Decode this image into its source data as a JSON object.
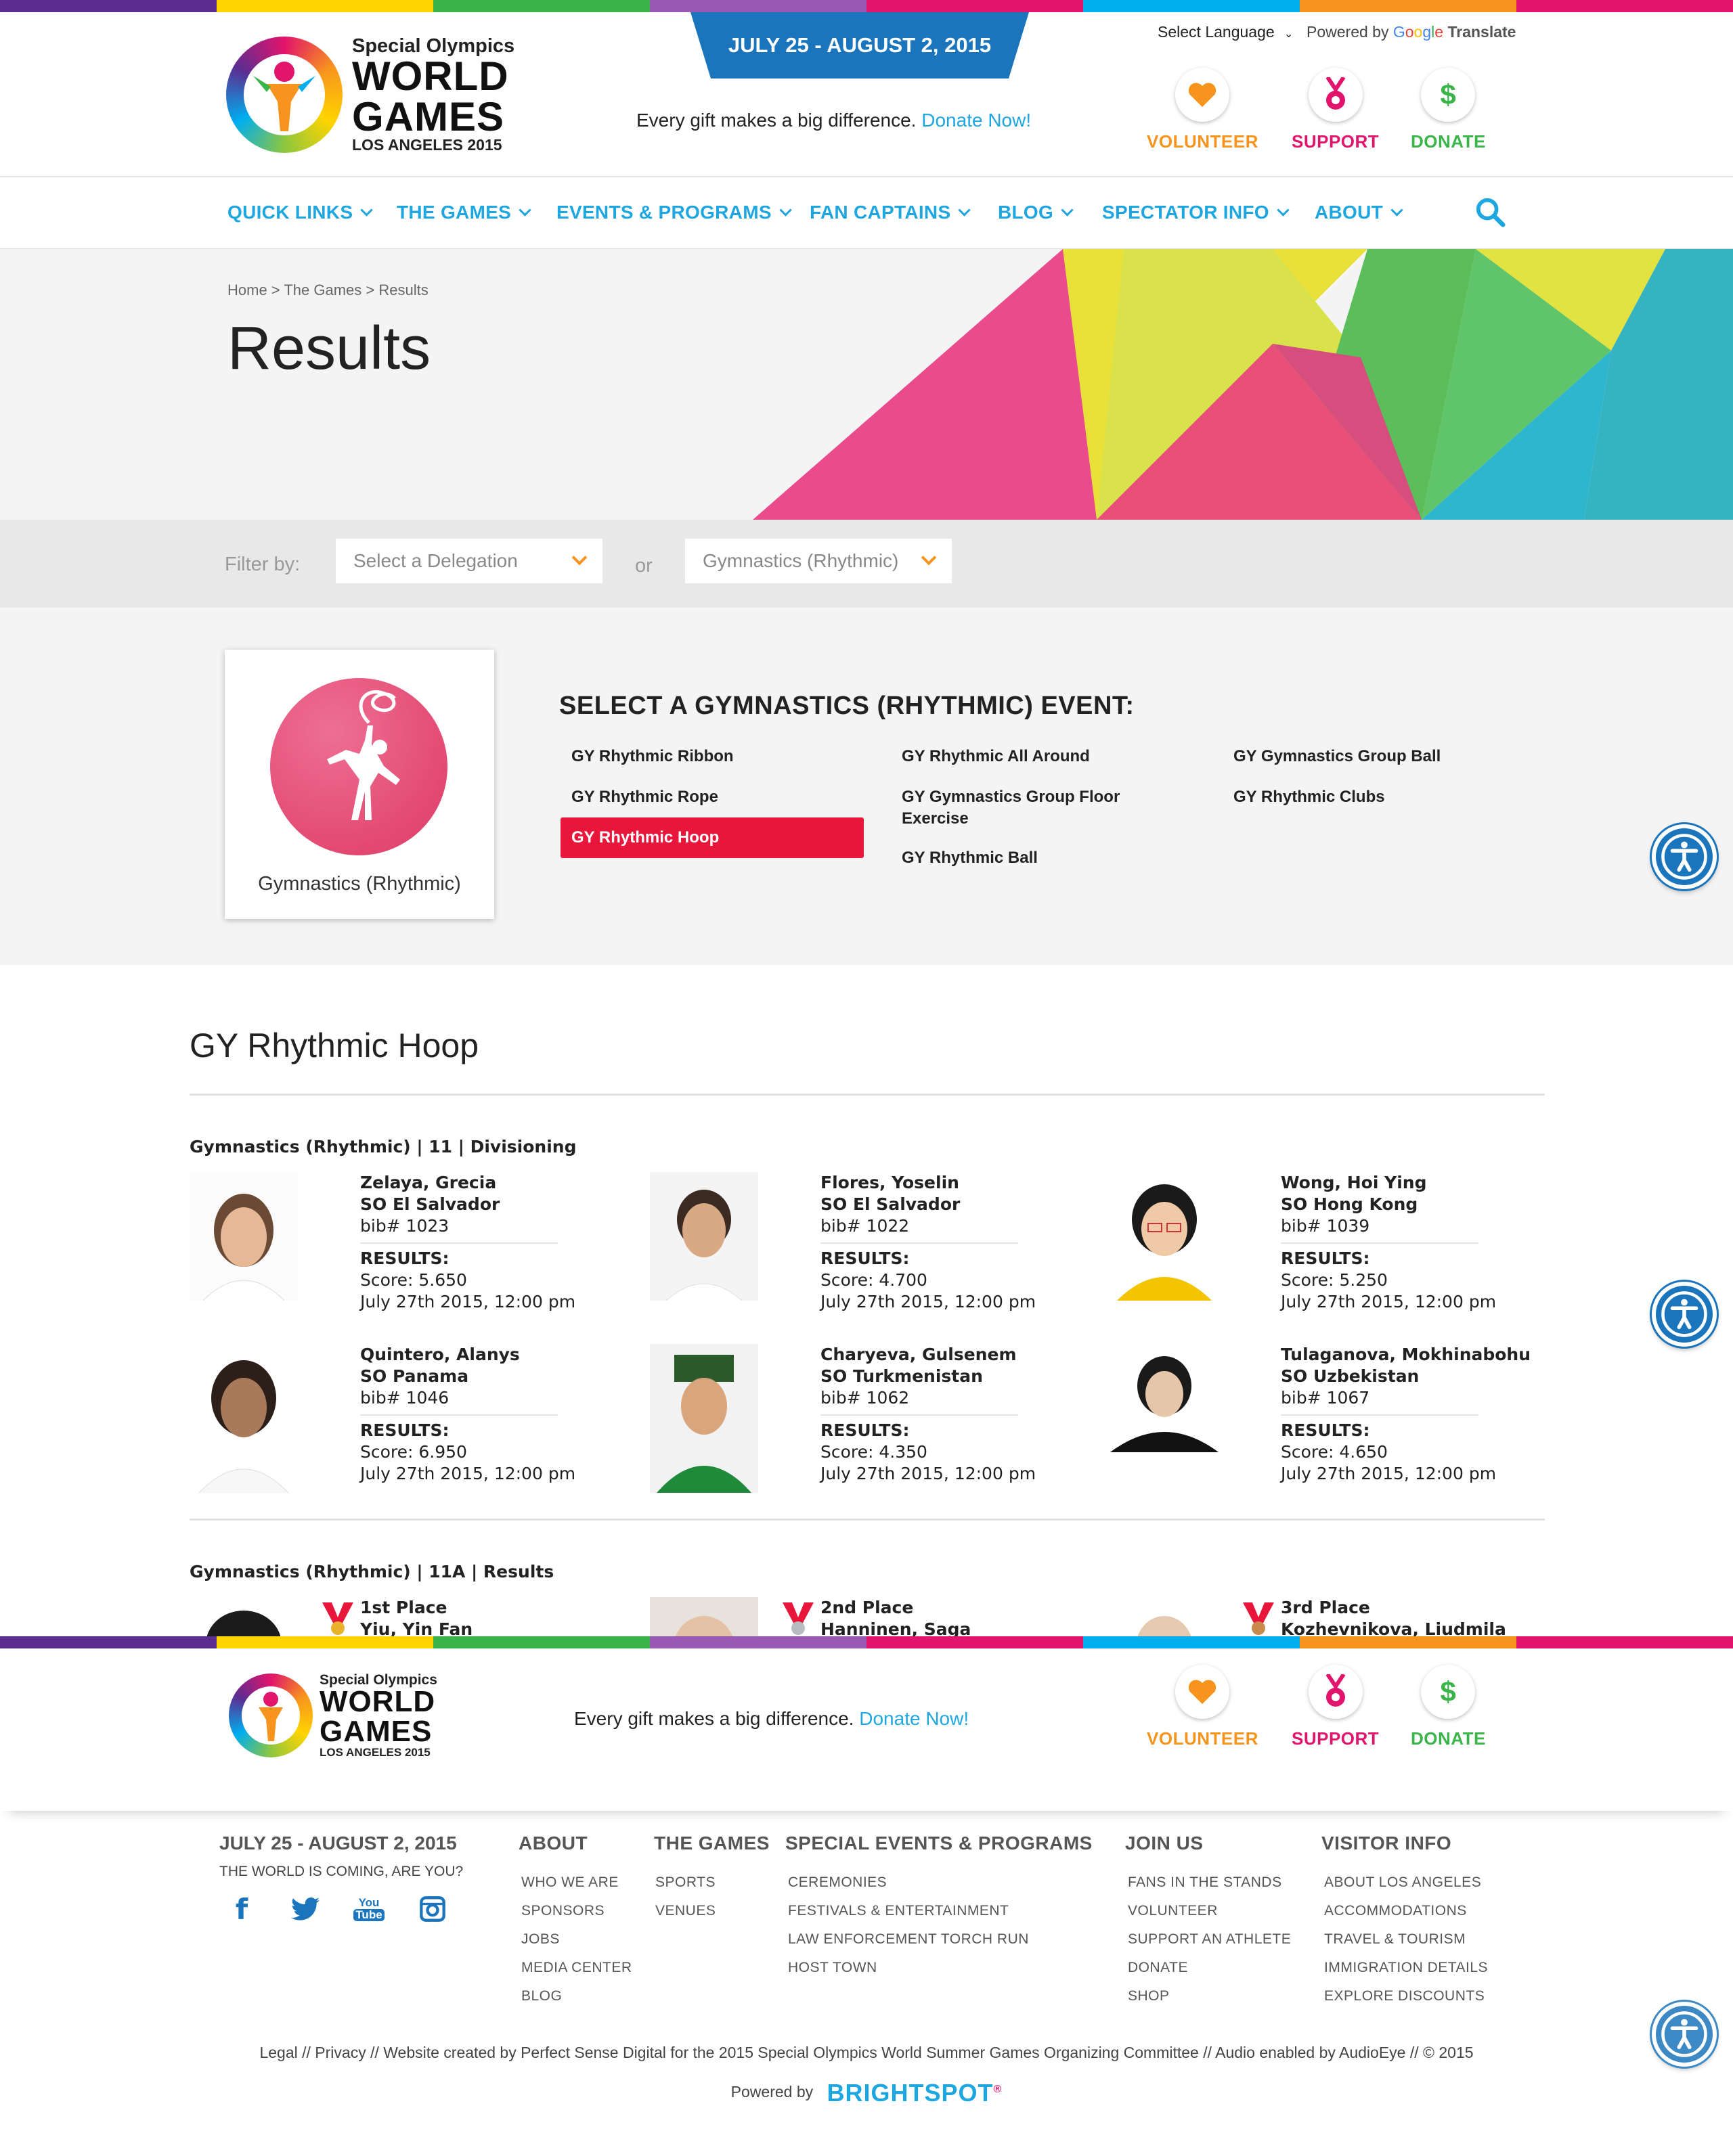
{
  "colors": {
    "blue": "#1ea6e0",
    "orange": "#f7941d",
    "magenta": "#e2146c",
    "green": "#39b54a",
    "red": "#e8163a"
  },
  "header": {
    "logo": {
      "line1": "Special Olympics",
      "line2": "WORLD",
      "line3": "GAMES",
      "line4": "LOS ANGELES 2015"
    },
    "date_banner": "JULY 25 - AUGUST 2, 2015",
    "donate_message": "Every gift makes a big difference.",
    "donate_link": "Donate Now!",
    "language": "Select Language",
    "powered_by": "Powered by",
    "translate": "Translate",
    "google": {
      "g": "G",
      "o1": "o",
      "o2": "o",
      "g2": "g",
      "l": "l",
      "e": "e"
    },
    "ctas": [
      {
        "label": "VOLUNTEER",
        "icon": "heart-icon"
      },
      {
        "label": "SUPPORT",
        "icon": "medal-icon"
      },
      {
        "label": "DONATE",
        "icon": "dollar-icon"
      }
    ]
  },
  "nav": {
    "items": [
      "QUICK LINKS",
      "THE GAMES",
      "EVENTS & PROGRAMS",
      "FAN CAPTAINS",
      "BLOG",
      "SPECTATOR INFO",
      "ABOUT"
    ]
  },
  "hero": {
    "breadcrumb": "Home > The Games > Results",
    "title": "Results"
  },
  "filter": {
    "label": "Filter by:",
    "delegation_placeholder": "Select a Delegation",
    "or": "or",
    "sport_value": "Gymnastics (Rhythmic)"
  },
  "events": {
    "sport_name": "Gymnastics (Rhythmic)",
    "heading": "SELECT A GYMNASTICS (RHYTHMIC) EVENT:",
    "col1": [
      "GY Rhythmic Ribbon",
      "GY Rhythmic Rope",
      "GY Rhythmic Hoop"
    ],
    "col2": [
      "GY Rhythmic All Around",
      "GY Gymnastics Group Floor Exercise",
      "GY Rhythmic Ball"
    ],
    "col3": [
      "GY Gymnastics Group Ball",
      "GY Rhythmic Clubs"
    ],
    "active": "GY Rhythmic Hoop"
  },
  "results": {
    "title": "GY Rhythmic Hoop",
    "group1": {
      "label": "Gymnastics (Rhythmic) | 11 | Divisioning",
      "athletes": [
        {
          "name": "Zelaya, Grecia",
          "delegation": "SO El Salvador",
          "bib": "bib# 1023",
          "results_label": "RESULTS:",
          "score": "Score: 5.650",
          "date": "July 27th 2015, 12:00 pm"
        },
        {
          "name": "Flores, Yoselin",
          "delegation": "SO El Salvador",
          "bib": "bib# 1022",
          "results_label": "RESULTS:",
          "score": "Score: 4.700",
          "date": "July 27th 2015, 12:00 pm"
        },
        {
          "name": "Wong, Hoi Ying",
          "delegation": "SO Hong Kong",
          "bib": "bib# 1039",
          "results_label": "RESULTS:",
          "score": "Score: 5.250",
          "date": "July 27th 2015, 12:00 pm"
        },
        {
          "name": "Quintero, Alanys",
          "delegation": "SO Panama",
          "bib": "bib# 1046",
          "results_label": "RESULTS:",
          "score": "Score: 6.950",
          "date": "July 27th 2015, 12:00 pm"
        },
        {
          "name": "Charyeva, Gulsenem",
          "delegation": "SO Turkmenistan",
          "bib": "bib# 1062",
          "results_label": "RESULTS:",
          "score": "Score: 4.350",
          "date": "July 27th 2015, 12:00 pm"
        },
        {
          "name": "Tulaganova, Mokhinabohu",
          "delegation": "SO Uzbekistan",
          "bib": "bib# 1067",
          "results_label": "RESULTS:",
          "score": "Score: 4.650",
          "date": "July 27th 2015, 12:00 pm"
        }
      ]
    },
    "group2": {
      "label": "Gymnastics (Rhythmic) | 11A | Results",
      "places": [
        {
          "place": "1st Place",
          "name": "Yiu, Yin Fan",
          "medal_color": "#e8b32a"
        },
        {
          "place": "2nd Place",
          "name": "Hanninen, Saga",
          "medal_color": "#b8bcc0"
        },
        {
          "place": "3rd Place",
          "name": "Kozhevnikova, Liudmila",
          "medal_color": "#c88a4a"
        }
      ]
    }
  },
  "footer": {
    "donate_message": "Every gift makes a big difference.",
    "donate_link": "Donate Now!",
    "date": "JULY 25 - AUGUST 2, 2015",
    "tagline": "THE WORLD IS COMING, ARE YOU?",
    "social": [
      "facebook-icon",
      "twitter-icon",
      "youtube-icon",
      "instagram-icon"
    ],
    "youtube": {
      "you": "You",
      "tube": "Tube"
    },
    "columns": [
      {
        "heading": "ABOUT",
        "items": [
          "WHO WE ARE",
          "SPONSORS",
          "JOBS",
          "MEDIA CENTER",
          "BLOG"
        ]
      },
      {
        "heading": "THE GAMES",
        "items": [
          "SPORTS",
          "VENUES"
        ]
      },
      {
        "heading": "SPECIAL EVENTS & PROGRAMS",
        "items": [
          "CEREMONIES",
          "FESTIVALS & ENTERTAINMENT",
          "LAW ENFORCEMENT TORCH RUN",
          "HOST TOWN"
        ]
      },
      {
        "heading": "JOIN US",
        "items": [
          "FANS IN THE STANDS",
          "VOLUNTEER",
          "SUPPORT AN ATHLETE",
          "DONATE",
          "SHOP"
        ]
      },
      {
        "heading": "VISITOR INFO",
        "items": [
          "ABOUT LOS ANGELES",
          "ACCOMMODATIONS",
          "TRAVEL & TOURISM",
          "IMMIGRATION DETAILS",
          "EXPLORE DISCOUNTS"
        ]
      }
    ],
    "legal": "Legal  //  Privacy  //  Website created by Perfect Sense Digital for the 2015 Special Olympics World Summer Games Organizing Committee // Audio enabled by AudioEye  //  © 2015",
    "powered_by": "Powered by",
    "brightspot": "BRIGHTSPOT",
    "reg": "®"
  }
}
